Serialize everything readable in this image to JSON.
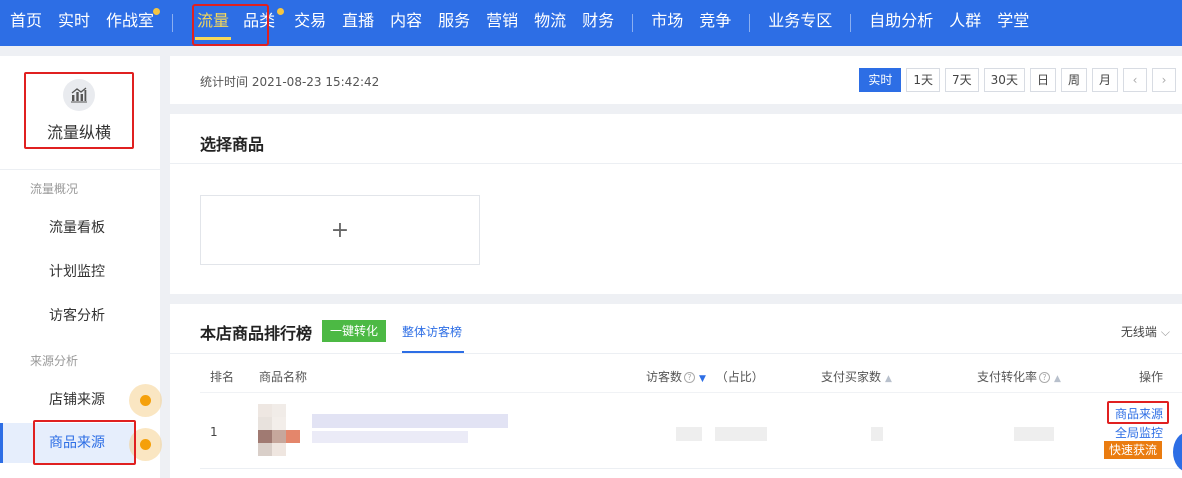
{
  "nav": {
    "items": [
      {
        "label": "首页",
        "dot": false,
        "active": false
      },
      {
        "label": "实时",
        "dot": false,
        "active": false
      },
      {
        "label": "作战室",
        "dot": true,
        "active": false
      },
      {
        "label": "流量",
        "dot": false,
        "active": true
      },
      {
        "label": "品类",
        "dot": true,
        "active": false
      },
      {
        "label": "交易",
        "dot": false,
        "active": false
      },
      {
        "label": "直播",
        "dot": false,
        "active": false
      },
      {
        "label": "内容",
        "dot": false,
        "active": false
      },
      {
        "label": "服务",
        "dot": false,
        "active": false
      },
      {
        "label": "营销",
        "dot": false,
        "active": false
      },
      {
        "label": "物流",
        "dot": false,
        "active": false
      },
      {
        "label": "财务",
        "dot": false,
        "active": false
      },
      {
        "label": "市场",
        "dot": false,
        "active": false
      },
      {
        "label": "竞争",
        "dot": false,
        "active": false
      },
      {
        "label": "业务专区",
        "dot": false,
        "active": false
      },
      {
        "label": "自助分析",
        "dot": false,
        "active": false
      },
      {
        "label": "人群",
        "dot": false,
        "active": false
      },
      {
        "label": "学堂",
        "dot": false,
        "active": false
      }
    ],
    "colors": {
      "bar": "#2d6ee5",
      "active": "#f7d85a",
      "dot": "#f5c542"
    }
  },
  "sidebar": {
    "title": "流量纵横",
    "icon": "chart-bar-icon",
    "groups": {
      "overview": "流量概况",
      "source": "来源分析"
    },
    "items": {
      "dashboard": "流量看板",
      "plan_monitor": "计划监控",
      "visitor_analysis": "访客分析",
      "store_source": "店铺来源",
      "product_source": "商品来源"
    },
    "active": "商品来源"
  },
  "stat": {
    "time_label": "统计时间 2021-08-23 15:42:42",
    "ranges": [
      "实时",
      "1天",
      "7天",
      "30天",
      "日",
      "周",
      "月"
    ],
    "active_range": "实时",
    "prev": "‹",
    "next": "›"
  },
  "select": {
    "title": "选择商品",
    "add": "+"
  },
  "ranking": {
    "title": "本店商品排行榜",
    "tag": "一键转化",
    "tab": "整体访客榜",
    "device": "无线端",
    "columns": {
      "rank": "排名",
      "name": "商品名称",
      "visitors": "访客数",
      "visitors_ratio": "（占比）",
      "buyers": "支付买家数",
      "conversion": "支付转化率",
      "action": "操作"
    },
    "rows": [
      {
        "rank": "1"
      }
    ],
    "actions": {
      "source": "商品来源",
      "monitor": "全局监控",
      "quick": "快速获流"
    },
    "colors": {
      "tag": "#4cb944",
      "quick": "#ea7c10",
      "link": "#2d6ee5",
      "highlight": "#e02020"
    }
  }
}
